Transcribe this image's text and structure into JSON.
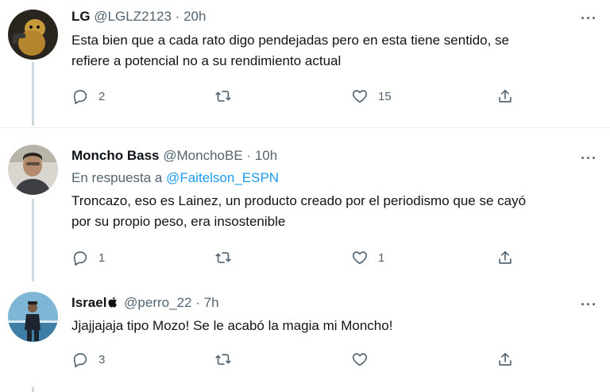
{
  "tweets": [
    {
      "name": "LG",
      "handle": "@LGLZ2123",
      "dot": "·",
      "time": "20h",
      "more": "···",
      "reply_prefix": "",
      "reply_target": "",
      "text_line1": "Esta bien que a cada rato digo pendejadas pero en esta tiene sentido, se",
      "text_line2": "refiere a potencial no a su rendimiento actual",
      "replies": "2",
      "retweets": "",
      "likes": "15"
    },
    {
      "name": "Moncho Bass",
      "handle": "@MonchoBE",
      "dot": "·",
      "time": "10h",
      "more": "···",
      "reply_prefix": "En respuesta a ",
      "reply_target": "@Faitelson_ESPN",
      "text_line1": "Troncazo, eso es Lainez, un producto creado por el periodismo que se cayó",
      "text_line2": "por su propio peso, era insostenible",
      "replies": "1",
      "retweets": "",
      "likes": "1"
    },
    {
      "name": "Israel",
      "handle": "@perro_22",
      "dot": "·",
      "time": "7h",
      "more": "···",
      "reply_prefix": "",
      "reply_target": "",
      "text_line1": "Jjajjajaja tipo Mozo!  Se le acabó la magia mi Moncho!",
      "text_line2": "",
      "replies": "3",
      "retweets": "",
      "likes": ""
    }
  ],
  "icons": {
    "reply": "reply-icon",
    "retweet": "retweet-icon",
    "like": "heart-icon",
    "share": "share-icon",
    "verified_emoji": "apple-icon"
  },
  "colors": {
    "text": "#0f1419",
    "secondary": "#536471",
    "link": "#1d9bf0",
    "thread": "#cfd9de",
    "divider": "#eff3f4"
  }
}
